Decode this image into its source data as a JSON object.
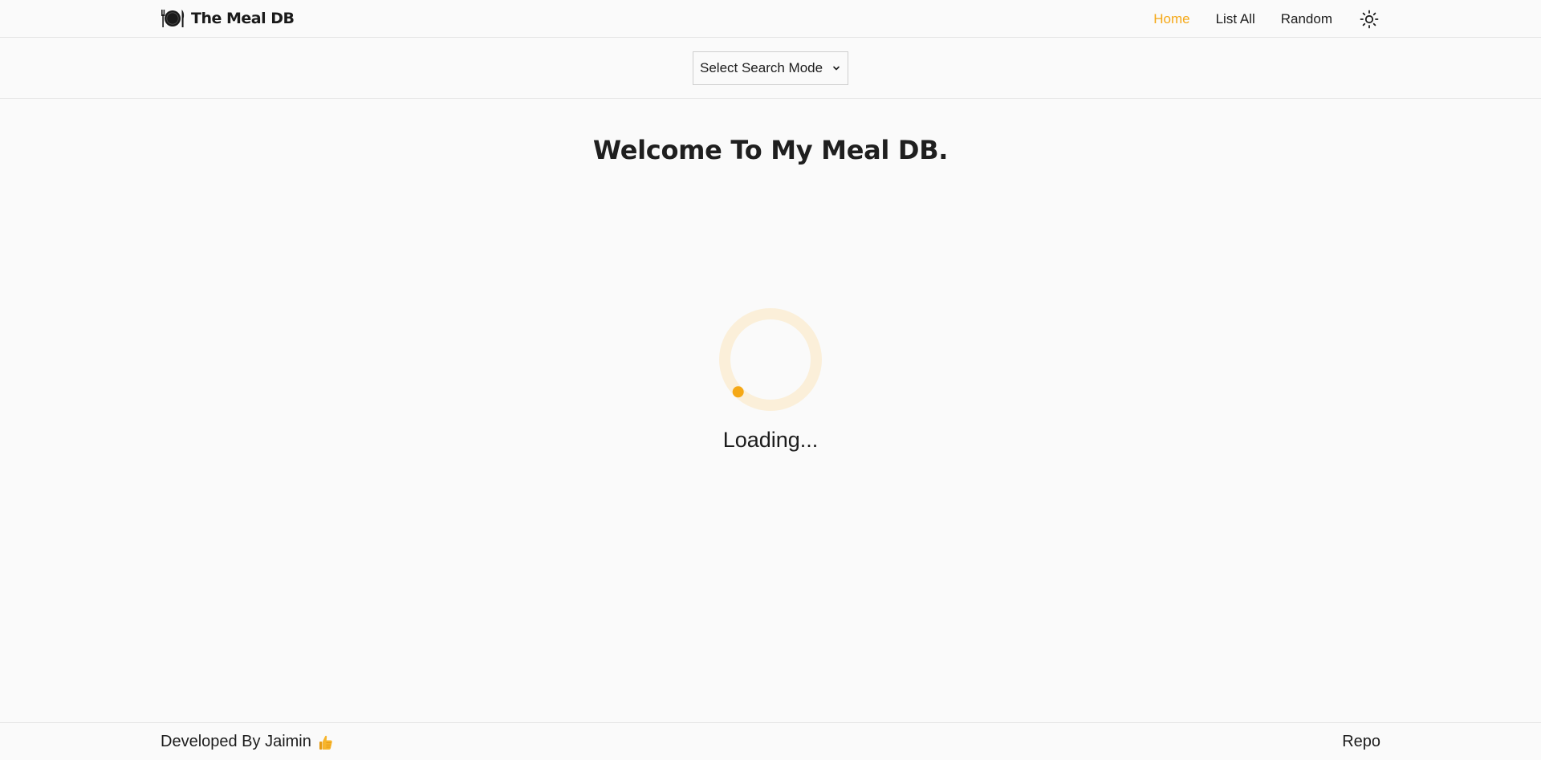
{
  "app": {
    "brand": "The Meal DB"
  },
  "nav": {
    "items": [
      {
        "label": "Home",
        "active": true
      },
      {
        "label": "List All",
        "active": false
      },
      {
        "label": "Random",
        "active": false
      }
    ],
    "theme_toggle_icon": "sun-icon"
  },
  "search": {
    "mode_select": "Select Search Mode"
  },
  "main": {
    "welcome": "Welcome To My Meal DB.",
    "loading_text": "Loading..."
  },
  "footer": {
    "credit": "Developed By Jaimin",
    "credit_icon": "thumbs-up-icon",
    "repo_link": "Repo"
  },
  "colors": {
    "accent": "#f5a816",
    "loader_track": "#fbefd9",
    "text": "#1c1c1c",
    "background": "#fafafa"
  }
}
